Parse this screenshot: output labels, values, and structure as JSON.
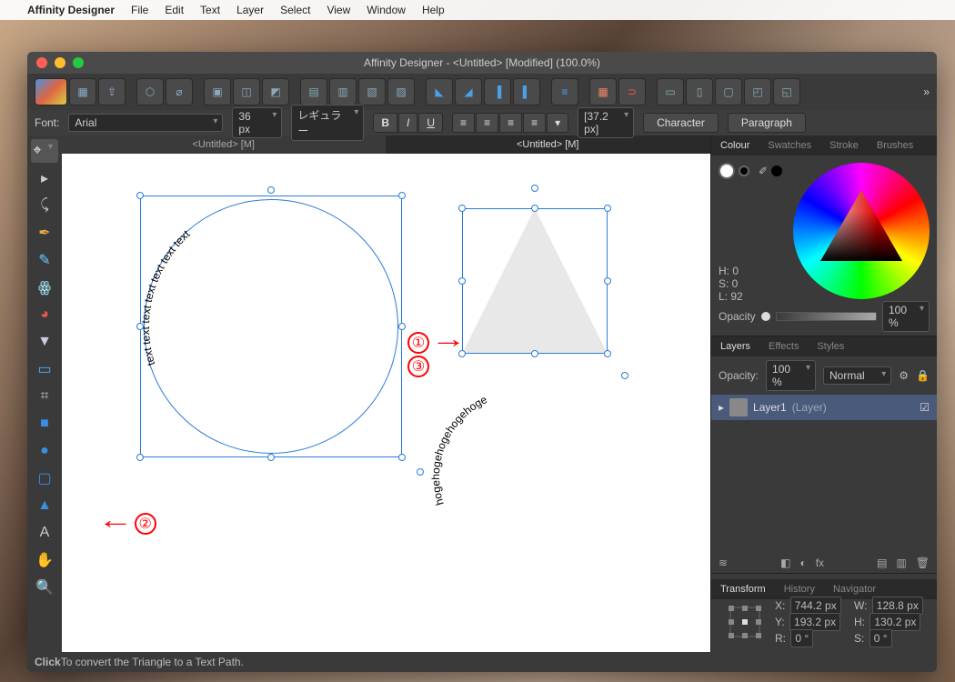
{
  "menubar": {
    "apple": "",
    "app": "Affinity Designer",
    "items": [
      "File",
      "Edit",
      "Text",
      "Layer",
      "Select",
      "View",
      "Window",
      "Help"
    ]
  },
  "window": {
    "title": "Affinity Designer - <Untitled> [Modified] (100.0%)"
  },
  "context": {
    "font_label": "Font:",
    "font": "Arial",
    "size": "36 px",
    "weight": "レギュラー",
    "bold": "B",
    "italic": "I",
    "underline": "U",
    "leading": "[37.2 px]",
    "char": "Character",
    "para": "Paragraph"
  },
  "doctabs": {
    "a": "<Untitled> [M]",
    "b": "<Untitled> [M]"
  },
  "status": {
    "label": "Click",
    "rest": " To convert the Triangle to a Text Path."
  },
  "panels": {
    "colour": {
      "tabs": [
        "Colour",
        "Swatches",
        "Stroke",
        "Brushes"
      ],
      "h": "H: 0",
      "s": "S: 0",
      "l": "L: 92",
      "opacity_label": "Opacity",
      "opacity": "100 %"
    },
    "layers": {
      "tabs": [
        "Layers",
        "Effects",
        "Styles"
      ],
      "opacity_label": "Opacity:",
      "opacity": "100 %",
      "blend": "Normal",
      "layer": "Layer1",
      "layer_hint": "(Layer)"
    },
    "transform": {
      "tabs": [
        "Transform",
        "History",
        "Navigator"
      ],
      "x_label": "X:",
      "x": "744.2 px",
      "w_label": "W:",
      "w": "128.8 px",
      "y_label": "Y:",
      "y": "193.2 px",
      "h_label": "H:",
      "h": "130.2 px",
      "r_label": "R:",
      "r": "0 °",
      "s_label": "S:",
      "s": "0 °"
    }
  },
  "canvas": {
    "circle_text": "text text text text text text text",
    "arc_text": "hogehogehogehogehoge",
    "annot1": "①",
    "annot2": "②",
    "annot3": "③"
  }
}
